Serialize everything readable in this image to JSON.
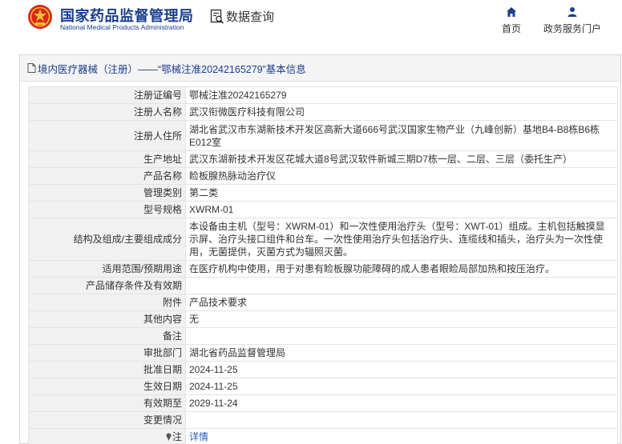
{
  "header": {
    "brand_cn": "国家药品监督管理局",
    "brand_en": "National Medical Products Administration",
    "query_label": "数据查询",
    "nav": [
      {
        "label": "首页",
        "icon": "home-icon"
      },
      {
        "label": "政务服务门户",
        "icon": "user-icon"
      }
    ]
  },
  "panel": {
    "title": "境内医疗器械（注册）——“鄂械注准20242165279”基本信息"
  },
  "rows": [
    {
      "key": "注册证编号",
      "value": "鄂械注准20242165279"
    },
    {
      "key": "注册人名称",
      "value": "武汉衔微医疗科技有限公司"
    },
    {
      "key": "注册人住所",
      "value": "湖北省武汉市东湖新技术开发区高新大道666号武汉国家生物产业（九峰创新）基地B4-B8栋B6栋E012室"
    },
    {
      "key": "生产地址",
      "value": "武汉东湖新技术开发区花城大道8号武汉软件新城三期D7栋一层、二层、三层（委托生产）"
    },
    {
      "key": "产品名称",
      "value": "睑板腺热脉动治疗仪"
    },
    {
      "key": "管理类别",
      "value": "第二类"
    },
    {
      "key": "型号规格",
      "value": "XWRM-01"
    },
    {
      "key": "结构及组成/主要组成成分",
      "value": "本设备由主机（型号：XWRM-01）和一次性使用治疗头（型号：XWT-01）组成。主机包括触摸显示屏、治疗头接口组件和台车。一次性使用治疗头包括治疗头、连缆线和插头，治疗头为一次性使用，无菌提供，灭菌方式为辐照灭菌。"
    },
    {
      "key": "适用范围/预期用途",
      "value": "在医疗机构中使用，用于对患有睑板腺功能障碍的成人患者眼睑局部加热和按压治疗。"
    },
    {
      "key": "产品储存条件及有效期",
      "value": ""
    },
    {
      "key": "附件",
      "value": "产品技术要求"
    },
    {
      "key": "其他内容",
      "value": "无"
    },
    {
      "key": "备注",
      "value": ""
    },
    {
      "key": "审批部门",
      "value": "湖北省药品监督管理局"
    },
    {
      "key": "批准日期",
      "value": "2024-11-25"
    },
    {
      "key": "生效日期",
      "value": "2024-11-25"
    },
    {
      "key": "有效期至",
      "value": "2029-11-24"
    },
    {
      "key": "变更情况",
      "value": ""
    }
  ],
  "note_row": {
    "key": "注",
    "link": "详情",
    "icon": "pin-icon"
  },
  "colors": {
    "brand_blue": "#1a3d8f",
    "link_blue": "#2a5bb8",
    "key_bg": "#f1f1f1"
  }
}
